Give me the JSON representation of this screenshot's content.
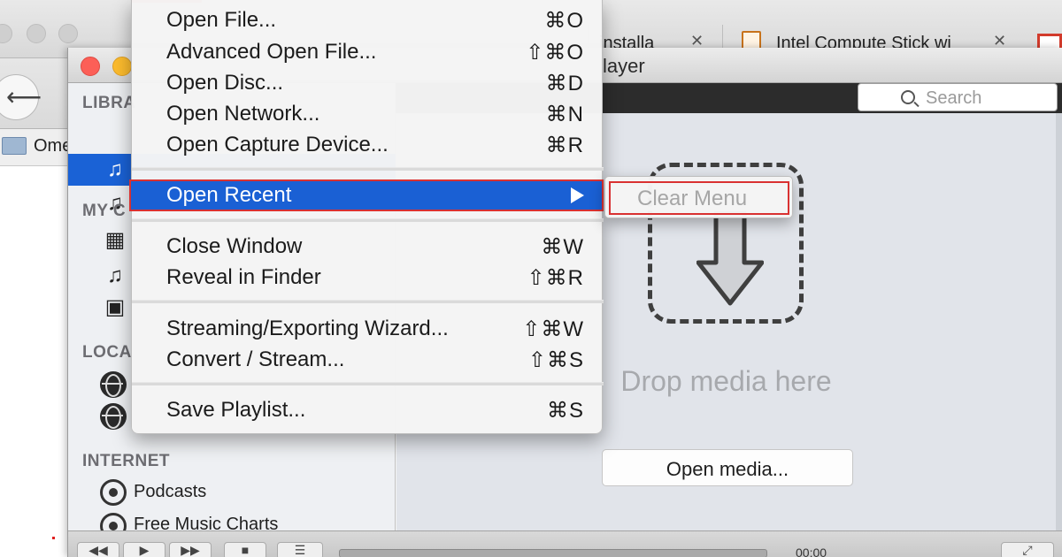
{
  "browser": {
    "tabs": [
      {
        "title": "installa",
        "close": "✕"
      },
      {
        "title": "Intel Compute Stick wi",
        "close": "✕"
      }
    ],
    "back_glyph": "⟵",
    "info_glyph": "i",
    "bookmark_label": "Ome"
  },
  "vlc": {
    "title": "layer",
    "search": {
      "placeholder": "Search"
    },
    "sidebar": {
      "library_heading": "LIBRA",
      "my_computer_heading": "MY C",
      "local_network_heading": "LOCA",
      "internet_heading": "INTERNET",
      "internet_items": [
        {
          "label": "Podcasts",
          "icon": "podcast-icon"
        },
        {
          "label": "Free Music Charts",
          "icon": "podcast-icon"
        }
      ]
    },
    "drop_text": "Drop media here",
    "open_media_label": "Open media...",
    "controls": {
      "time": "00:00",
      "menu_glyph": "☰"
    }
  },
  "file_menu": {
    "groups": [
      [
        {
          "label": "Open File...",
          "shortcut": "⌘O"
        },
        {
          "label": "Advanced Open File...",
          "shortcut": "⇧⌘O"
        },
        {
          "label": "Open Disc...",
          "shortcut": "⌘D"
        },
        {
          "label": "Open Network...",
          "shortcut": "⌘N"
        },
        {
          "label": "Open Capture Device...",
          "shortcut": "⌘R"
        }
      ],
      [
        {
          "label": "Open Recent",
          "submenu": true,
          "highlighted": true
        }
      ],
      [
        {
          "label": "Close Window",
          "shortcut": "⌘W"
        },
        {
          "label": "Reveal in Finder",
          "shortcut": "⇧⌘R"
        }
      ],
      [
        {
          "label": "Streaming/Exporting Wizard...",
          "shortcut": "⇧⌘W"
        },
        {
          "label": "Convert / Stream...",
          "shortcut": "⇧⌘S"
        }
      ],
      [
        {
          "label": "Save Playlist...",
          "shortcut": "⌘S"
        }
      ]
    ],
    "open_recent_submenu": {
      "item": "Clear Menu",
      "enabled": false
    }
  },
  "colors": {
    "menu_highlight": "#1a60d4",
    "annotation_red": "#d93131",
    "close_red": "#fc5f57",
    "minimize_yellow": "#fdbc2e"
  }
}
